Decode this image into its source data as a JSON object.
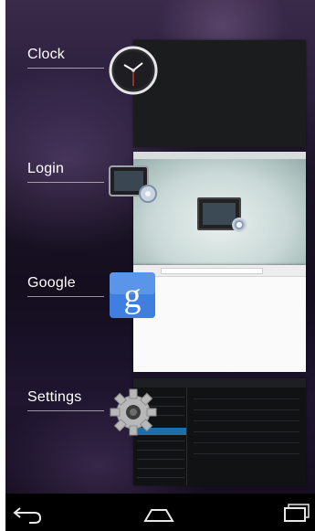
{
  "recents": {
    "apps": [
      {
        "label": "Clock"
      },
      {
        "label": "Login"
      },
      {
        "label": "Google"
      },
      {
        "label": "Settings"
      }
    ]
  },
  "navbar": {
    "back_icon": "back-icon",
    "home_icon": "home-icon",
    "recents_icon": "recents-icon"
  },
  "colors": {
    "google_blue": "#3f7fe0",
    "settings_selection": "#1c6fa8"
  }
}
